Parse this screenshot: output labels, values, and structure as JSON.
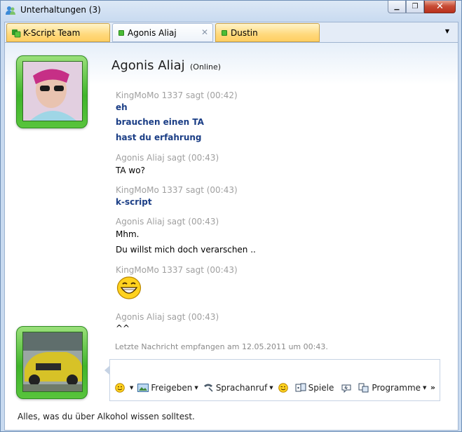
{
  "window": {
    "title": "Unterhaltungen (3)",
    "close_glyph": "✕",
    "minimize_glyph": "▁",
    "maximize_glyph": "❐"
  },
  "tabs": [
    {
      "label": "K-Script Team",
      "icon": "group-icon"
    },
    {
      "label": "Agonis Aliaj",
      "icon": "status-online-icon",
      "close_glyph": "✕"
    },
    {
      "label": "Dustin",
      "icon": "status-online-icon"
    }
  ],
  "tab_overflow_glyph": "▼",
  "contact": {
    "name": "Agonis Aliaj",
    "status": "(Online)"
  },
  "messages": [
    {
      "header": "KingMoMo 1337 sagt (00:42)",
      "lines": [
        "eh",
        "brauchen einen TA",
        "hast du erfahrung"
      ],
      "mine": true
    },
    {
      "header": "Agonis Aliaj sagt (00:43)",
      "lines": [
        "TA wo?"
      ],
      "mine": false
    },
    {
      "header": "KingMoMo 1337 sagt (00:43)",
      "lines": [
        "k-script"
      ],
      "mine": true
    },
    {
      "header": "Agonis Aliaj sagt (00:43)",
      "lines": [
        "Mhm.",
        "Du willst mich doch verarschen .."
      ],
      "mine": false
    },
    {
      "header": "KingMoMo 1337 sagt (00:43)",
      "lines": [],
      "emoticon": "laughing-smiley",
      "mine": true
    },
    {
      "header": "Agonis Aliaj sagt (00:43)",
      "lines": [
        "^^"
      ],
      "mine": false
    }
  ],
  "last_received": "Letzte Nachricht empfangen am 12.05.2011 um 00:43.",
  "toolbar": {
    "share_label": "Freigeben",
    "call_label": "Sprachanruf",
    "games_label": "Spiele",
    "programs_label": "Programme",
    "overflow_glyph": "»"
  },
  "footer": "Alles, was du über Alkohol wissen solltest.",
  "colors": {
    "own_message": "#1b3e86",
    "header_gray": "#a0a0a0",
    "avatar_frame": "#3fb42a",
    "tab_yellow": "#ffd97c"
  }
}
